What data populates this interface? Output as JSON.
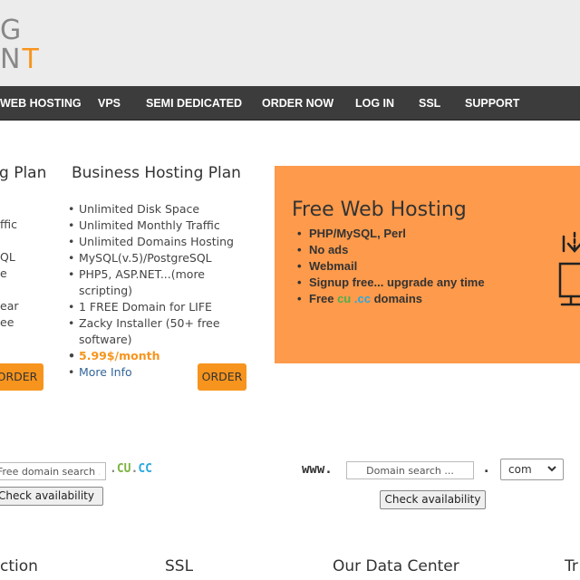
{
  "logo": {
    "line1": "G",
    "line2_prefix": "N",
    "line2_accent": "T"
  },
  "nav": {
    "items": [
      {
        "label": "WEB HOSTING"
      },
      {
        "label": "VPS"
      },
      {
        "label": "SEMI DEDICATED"
      },
      {
        "label": "ORDER NOW"
      },
      {
        "label": "LOG IN"
      },
      {
        "label": "SSL"
      },
      {
        "label": "SUPPORT"
      }
    ]
  },
  "plan_left": {
    "title_fragment": "g Plan",
    "fragments": [
      "ffic",
      "QL",
      "e",
      "ear",
      "ee"
    ],
    "order_label": "ORDER"
  },
  "plan_business": {
    "title": "Business Hosting Plan",
    "features": [
      "Unlimited Disk Space",
      "Unlimited Monthly Traffic",
      "Unlimited Domains Hosting",
      "MySQL(v.5)/PostgreSQL",
      "PHP5, ASP.NET...(more scripting)",
      "1 FREE Domain for LIFE",
      "Zacky Installer (50+ free software)"
    ],
    "price": "5.99$/month",
    "more_info": "More Info",
    "order_label": "ORDER"
  },
  "free_hosting": {
    "title": "Free Web Hosting",
    "items": [
      "PHP/MySQL, Perl",
      "No ads",
      "Webmail",
      "Signup free... upgrade any time"
    ],
    "domains_prefix": "Free ",
    "domain_cu": "cu",
    "domain_sep": " .",
    "domain_cc": "cc",
    "domains_suffix": " domains",
    "icon": "monitor-download-icon",
    "accent_color": "#fd9a4b"
  },
  "free_domain_search": {
    "placeholder": "Free domain search ...",
    "tld_dot1": ".",
    "tld_cu": "CU",
    "tld_dot2": ".",
    "tld_cc": "CC",
    "check_label": "Check availability"
  },
  "domain_search": {
    "prefix": "www.",
    "placeholder": "Domain search ...",
    "separator": ".",
    "tld_selected": "com",
    "check_label": "Check availability"
  },
  "footer_titles": [
    "ction",
    "SSL",
    "Our Data Center",
    "Tr"
  ]
}
